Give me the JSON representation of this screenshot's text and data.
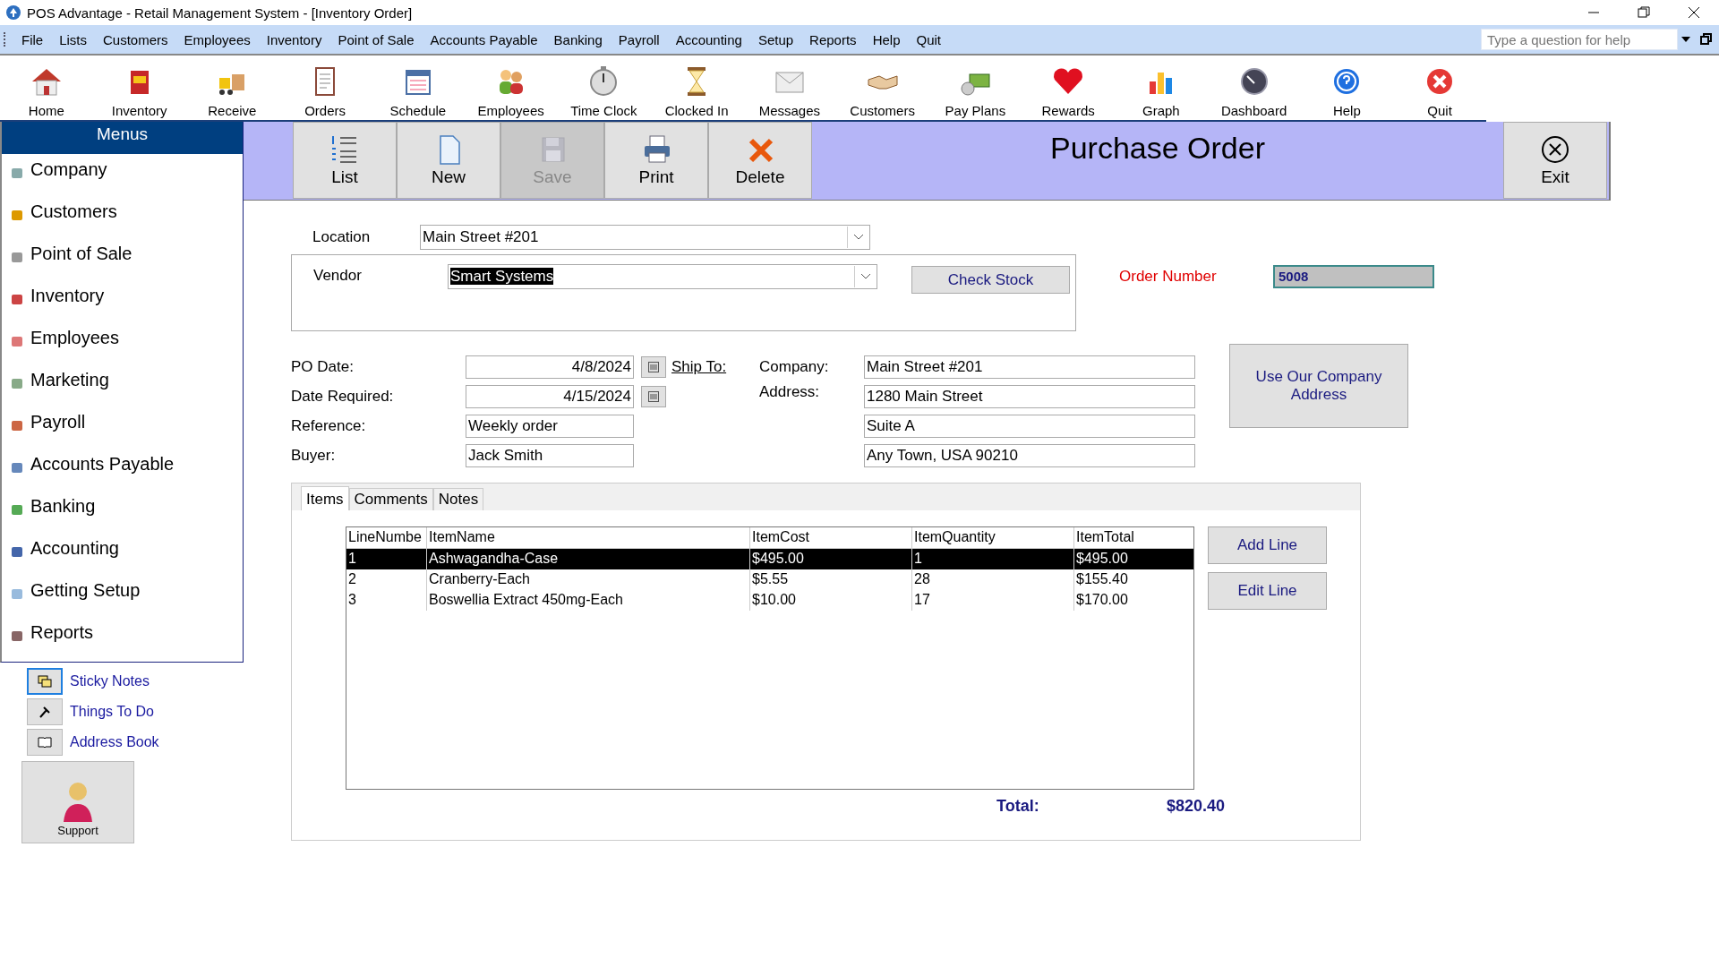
{
  "window": {
    "title": "POS Advantage - Retail Management System - [Inventory Order]"
  },
  "menu_bar": [
    "File",
    "Lists",
    "Customers",
    "Employees",
    "Inventory",
    "Point of Sale",
    "Accounts Payable",
    "Banking",
    "Payroll",
    "Accounting",
    "Setup",
    "Reports",
    "Help",
    "Quit"
  ],
  "help_search": {
    "placeholder": "Type a question for help"
  },
  "toolbar": [
    {
      "label": "Home"
    },
    {
      "label": "Inventory"
    },
    {
      "label": "Receive"
    },
    {
      "label": "Orders"
    },
    {
      "label": "Schedule"
    },
    {
      "label": "Employees"
    },
    {
      "label": "Time Clock"
    },
    {
      "label": "Clocked In"
    },
    {
      "label": "Messages"
    },
    {
      "label": "Customers"
    },
    {
      "label": "Pay Plans"
    },
    {
      "label": "Rewards"
    },
    {
      "label": "Graph"
    },
    {
      "label": "Dashboard"
    },
    {
      "label": "Help"
    },
    {
      "label": "Quit"
    }
  ],
  "sidebar": {
    "title": "Menus",
    "items": [
      "Company",
      "Customers",
      "Point of Sale",
      "Inventory",
      "Employees",
      "Marketing",
      "Payroll",
      "Accounts Payable",
      "Banking",
      "Accounting",
      "Getting Setup",
      "Reports"
    ],
    "links": [
      "Sticky Notes",
      "Things To Do",
      "Address Book"
    ],
    "support_button": "Support"
  },
  "form": {
    "title": "Purchase Order",
    "actions": [
      {
        "label": "List",
        "disabled": false
      },
      {
        "label": "New",
        "disabled": false
      },
      {
        "label": "Save",
        "disabled": true
      },
      {
        "label": "Print",
        "disabled": false
      },
      {
        "label": "Delete",
        "disabled": false
      }
    ],
    "exit_button": "Exit",
    "location": {
      "label": "Location",
      "value": "Main Street #201"
    },
    "vendor": {
      "label": "Vendor",
      "value": "Smart Systems"
    },
    "check_stock_button": "Check Stock",
    "order_number": {
      "label": "Order Number",
      "value": "5008"
    },
    "fields": [
      {
        "label": "PO Date:",
        "value": "4/8/2024",
        "kind": "date"
      },
      {
        "label": "Date Required:",
        "value": "4/15/2024",
        "kind": "date"
      },
      {
        "label": "Reference:",
        "value": "Weekly order",
        "kind": "text"
      },
      {
        "label": "Buyer:",
        "value": "Jack Smith",
        "kind": "text"
      }
    ],
    "ship_to": {
      "label": "Ship To:",
      "company_label": "Company:",
      "address_label": "Address:",
      "lines": [
        "Main Street #201",
        "1280 Main Street",
        "Suite A",
        "Any Town, USA 90210"
      ]
    },
    "use_company_address_button": "Use Our Company Address",
    "tabs": [
      {
        "label": "Items",
        "selected": true
      },
      {
        "label": "Comments",
        "selected": false
      },
      {
        "label": "Notes",
        "selected": false
      }
    ],
    "table": {
      "columns": [
        "LineNumbe",
        "ItemName",
        "ItemCost",
        "ItemQuantity",
        "ItemTotal"
      ],
      "rows": [
        {
          "cells": [
            "1",
            "Ashwagandha-Case",
            "$495.00",
            "1",
            "$495.00"
          ],
          "selected": true
        },
        {
          "cells": [
            "2",
            "Cranberry-Each",
            "$5.55",
            "28",
            "$155.40"
          ],
          "selected": false
        },
        {
          "cells": [
            "3",
            "Boswellia Extract 450mg-Each",
            "$10.00",
            "17",
            "$170.00"
          ],
          "selected": false
        }
      ]
    },
    "add_line_button": "Add Line",
    "edit_line_button": "Edit Line",
    "total": {
      "label": "Total:",
      "value": "$820.40"
    }
  }
}
